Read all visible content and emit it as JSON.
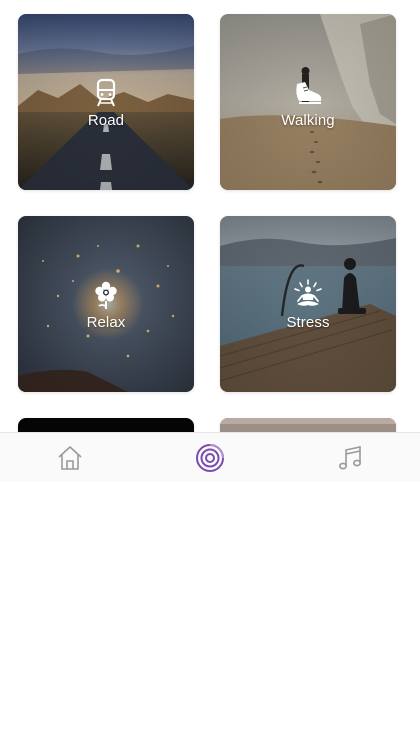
{
  "tiles": [
    {
      "id": "road",
      "label": "Road",
      "icon": "train-icon"
    },
    {
      "id": "walking",
      "label": "Walking",
      "icon": "shoe-icon"
    },
    {
      "id": "relax",
      "label": "Relax",
      "icon": "flower-icon"
    },
    {
      "id": "stress",
      "label": "Stress",
      "icon": "meditation-icon"
    },
    {
      "id": "tile-5",
      "label": "",
      "icon": ""
    },
    {
      "id": "tile-6",
      "label": "",
      "icon": ""
    }
  ],
  "bottom_nav": {
    "items": [
      {
        "icon": "home-icon",
        "active": false
      },
      {
        "icon": "target-icon",
        "active": true
      },
      {
        "icon": "music-note-icon",
        "active": false
      }
    ],
    "colors": {
      "inactive": "#9a9a9a",
      "active": "#7b4bb0"
    }
  }
}
